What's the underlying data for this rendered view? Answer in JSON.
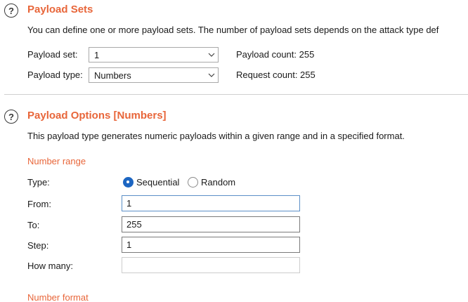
{
  "payload_sets": {
    "title": "Payload Sets",
    "description": "You can define one or more payload sets. The number of payload sets depends on the attack type def",
    "set_label": "Payload set:",
    "set_value": "1",
    "type_label": "Payload type:",
    "type_value": "Numbers",
    "payload_count": "Payload count: 255",
    "request_count": "Request count: 255"
  },
  "payload_options": {
    "title": "Payload Options [Numbers]",
    "description": "This payload type generates numeric payloads within a given range and in a specified format.",
    "number_range": {
      "title": "Number range",
      "type_label": "Type:",
      "radio_sequential": "Sequential",
      "radio_random": "Random",
      "selected": "Sequential",
      "from_label": "From:",
      "from_value": "1",
      "to_label": "To:",
      "to_value": "255",
      "step_label": "Step:",
      "step_value": "1",
      "howmany_label": "How many:",
      "howmany_value": ""
    },
    "number_format_title": "Number format"
  },
  "icons": {
    "help": "help-circle-icon",
    "chevron": "chevron-down-icon"
  },
  "colors": {
    "accent": "#e8663a",
    "radio": "#1d66c2",
    "focus_border": "#5b8fc7"
  }
}
